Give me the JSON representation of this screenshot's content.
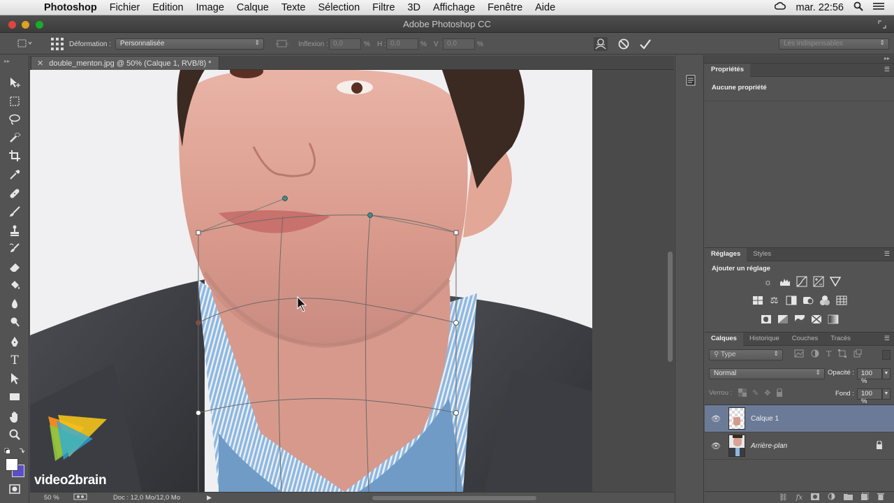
{
  "menubar": {
    "app_name": "Photoshop",
    "items": [
      "Fichier",
      "Edition",
      "Image",
      "Calque",
      "Texte",
      "Sélection",
      "Filtre",
      "3D",
      "Affichage",
      "Fenêtre",
      "Aide"
    ],
    "clock": "mar. 22:56"
  },
  "window": {
    "title": "Adobe Photoshop CC"
  },
  "options_bar": {
    "warp_label": "Déformation :",
    "warp_value": "Personnalisée",
    "bend_label": "Inflexion :",
    "bend_value": "0,0",
    "h_label": "H :",
    "h_value": "0,0",
    "v_label": "V :",
    "v_value": "0,0",
    "percent": "%",
    "workspace": "Les indispensables"
  },
  "document": {
    "tab_title": "double_menton.jpg @ 50% (Calque 1, RVB/8) *",
    "zoom": "50 %",
    "doc_info": "Doc : 12,0 Mo/12,0 Mo"
  },
  "watermark": {
    "text": "video2brain"
  },
  "properties_panel": {
    "tab": "Propriétés",
    "content": "Aucune propriété"
  },
  "adjustments_panel": {
    "tabs": [
      "Réglages",
      "Styles"
    ],
    "heading": "Ajouter un réglage"
  },
  "layers_panel": {
    "tabs": [
      "Calques",
      "Historique",
      "Couches",
      "Tracés"
    ],
    "filter_placeholder": "Type",
    "blend_mode": "Normal",
    "opacity_label": "Opacité :",
    "opacity_value": "100 %",
    "lock_label": "Verrou :",
    "fill_label": "Fond :",
    "fill_value": "100 %",
    "layers": [
      {
        "name": "Calque 1",
        "selected": true,
        "locked": false
      },
      {
        "name": "Arrière-plan",
        "selected": false,
        "locked": true
      }
    ]
  },
  "colors": {
    "accent_selected": "#6b7a96",
    "ui_gray": "#535353"
  }
}
